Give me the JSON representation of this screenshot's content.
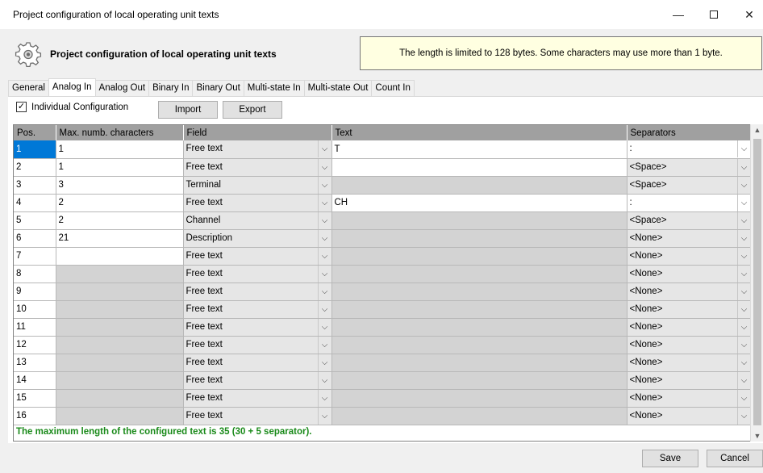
{
  "window": {
    "title": "Project configuration of local operating unit texts",
    "minimize": "—",
    "close": "✕"
  },
  "header": {
    "title": "Project configuration of local operating unit texts",
    "info": "The length is limited to 128 bytes. Some characters may use more than 1 byte."
  },
  "tabs": [
    {
      "label": "General",
      "active": false
    },
    {
      "label": "Analog In",
      "active": true
    },
    {
      "label": "Analog Out",
      "active": false
    },
    {
      "label": "Binary In",
      "active": false
    },
    {
      "label": "Binary Out",
      "active": false
    },
    {
      "label": "Multi-state In",
      "active": false
    },
    {
      "label": "Multi-state Out",
      "active": false
    },
    {
      "label": "Count In",
      "active": false
    }
  ],
  "toolbar": {
    "individual_config_label": "Individual Configuration",
    "individual_config_checked": true,
    "check_mark": "✓",
    "import_label": "Import",
    "export_label": "Export"
  },
  "grid": {
    "columns": [
      "Pos.",
      "Max. numb. characters",
      "Field",
      "Text",
      "Separators"
    ],
    "rows": [
      {
        "pos": "1",
        "max": "1",
        "field": "Free text",
        "text": "T",
        "sep": ":"
      },
      {
        "pos": "2",
        "max": "1",
        "field": "Free text",
        "text": "",
        "sep": "<Space>"
      },
      {
        "pos": "3",
        "max": "3",
        "field": "Terminal",
        "text": "",
        "sep": "<Space>"
      },
      {
        "pos": "4",
        "max": "2",
        "field": "Free text",
        "text": "CH",
        "sep": ":"
      },
      {
        "pos": "5",
        "max": "2",
        "field": "Channel",
        "text": "",
        "sep": "<Space>"
      },
      {
        "pos": "6",
        "max": "21",
        "field": "Description",
        "text": "",
        "sep": "<None>"
      },
      {
        "pos": "7",
        "max": "",
        "field": "Free text",
        "text": "",
        "sep": "<None>"
      },
      {
        "pos": "8",
        "max": "",
        "field": "Free text",
        "text": "",
        "sep": "<None>"
      },
      {
        "pos": "9",
        "max": "",
        "field": "Free text",
        "text": "",
        "sep": "<None>"
      },
      {
        "pos": "10",
        "max": "",
        "field": "Free text",
        "text": "",
        "sep": "<None>"
      },
      {
        "pos": "11",
        "max": "",
        "field": "Free text",
        "text": "",
        "sep": "<None>"
      },
      {
        "pos": "12",
        "max": "",
        "field": "Free text",
        "text": "",
        "sep": "<None>"
      },
      {
        "pos": "13",
        "max": "",
        "field": "Free text",
        "text": "",
        "sep": "<None>"
      },
      {
        "pos": "14",
        "max": "",
        "field": "Free text",
        "text": "",
        "sep": "<None>"
      },
      {
        "pos": "15",
        "max": "",
        "field": "Free text",
        "text": "",
        "sep": "<None>"
      },
      {
        "pos": "16",
        "max": "",
        "field": "Free text",
        "text": "",
        "sep": "<None>"
      }
    ],
    "footer": "The maximum length of the configured text is 35 (30 + 5 separator)."
  },
  "buttons": {
    "save": "Save",
    "cancel": "Cancel"
  },
  "colors": {
    "selection": "#0078d7",
    "footer_text": "#1a8a1a",
    "info_bg": "#ffffe1"
  }
}
